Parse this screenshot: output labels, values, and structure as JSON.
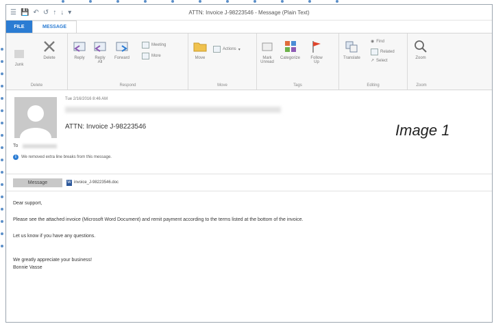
{
  "window": {
    "title": "ATTN: Invoice J-98223546 - Message (Plain Text)"
  },
  "tabs": {
    "file": "FILE",
    "message": "MESSAGE"
  },
  "ribbon": {
    "delete_group": {
      "ignore": "Junk",
      "delete": "Delete",
      "label": "Delete"
    },
    "respond_group": {
      "reply": "Reply",
      "reply_all_1": "Reply",
      "reply_all_2": "All",
      "forward": "Forward",
      "meeting": "Meeting",
      "more": "More",
      "label": "Respond"
    },
    "move_group": {
      "move": "Move",
      "actions": "Actions",
      "label": "Move"
    },
    "tags_group": {
      "mark_unread_1": "Mark",
      "mark_unread_2": "Unread",
      "categorize": "Categorize",
      "follow_up_1": "Follow",
      "follow_up_2": "Up",
      "label": "Tags"
    },
    "editing_group": {
      "translate": "Translate",
      "find": "Find",
      "related": "Related",
      "select": "Select",
      "label": "Editing"
    },
    "zoom_group": {
      "zoom": "Zoom",
      "label": "Zoom"
    }
  },
  "message": {
    "date": "Tue 2/16/2016 8:46 AM",
    "subject": "ATTN: Invoice J-98223546",
    "to_label": "To",
    "info": "We removed extra line breaks from this message.",
    "image_label": "Image 1"
  },
  "attachments": {
    "message_tab": "Message",
    "file": "invoice_J-98223546.doc"
  },
  "body": {
    "greeting": "Dear support,",
    "line1": "Please see the attached invoice (Microsoft Word Document) and remit payment according to the terms listed at the bottom of the invoice.",
    "line2": "Let us know if you have any questions.",
    "closing": "We greatly appreciate your business!",
    "signature": "Bonnie Vasse"
  }
}
